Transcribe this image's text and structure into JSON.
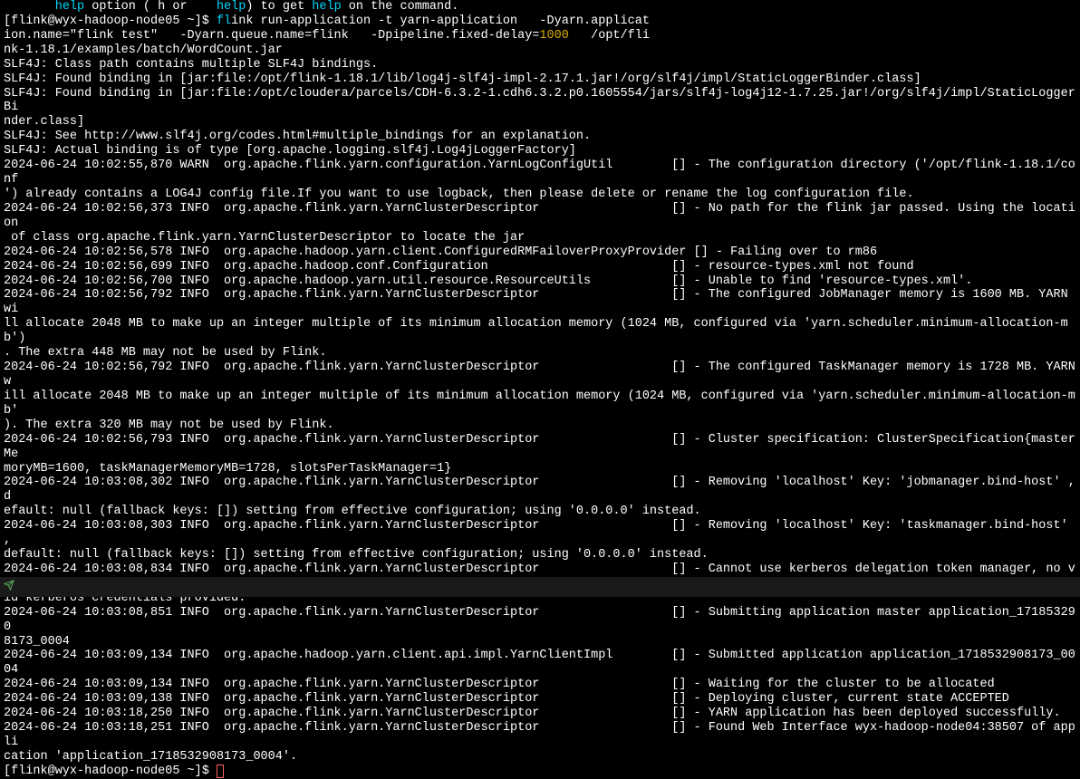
{
  "line0_prefix": "       ",
  "line0_word1": "help",
  "line0_mid": " option ( h or ",
  "line0_word2": "   help",
  "line0_mid2": ") to get ",
  "line0_word3": "help",
  "line0_end": " on the command.",
  "prompt1": "[flink@wyx-hadoop-node05 ~]$ ",
  "cmd_fl": "fl",
  "cmd_rest": "ink run-application -t yarn-application   -Dyarn.applicat\nion.name=\"flink test\"   -Dyarn.queue.name=flink   -Dpipeline.fixed-delay=",
  "cmd_1000": "1000",
  "cmd_path": "   /opt/fli\nnk-1.18.1/examples/batch/WordCount.jar",
  "slf4j_1": "SLF4J: Class path contains multiple SLF4J bindings.",
  "slf4j_2": "SLF4J: Found binding in [jar:file:/opt/flink-1.18.1/lib/log4j-slf4j-impl-2.17.1.jar!/org/slf4j/impl/StaticLoggerBinder.class]",
  "slf4j_3": "SLF4J: Found binding in [jar:file:/opt/cloudera/parcels/CDH-6.3.2-1.cdh6.3.2.p0.1605554/jars/slf4j-log4j12-1.7.25.jar!/org/slf4j/impl/StaticLoggerBi\nnder.class]",
  "slf4j_4": "SLF4J: See http://www.slf4j.org/codes.html#multiple_bindings for an explanation.",
  "slf4j_5": "SLF4J: Actual binding is of type [org.apache.logging.slf4j.Log4jLoggerFactory]",
  "log1": "2024-06-24 10:02:55,870 WARN  org.apache.flink.yarn.configuration.YarnLogConfigUtil        [] - The configuration directory ('/opt/flink-1.18.1/conf\n') already contains a LOG4J config file.If you want to use logback, then please delete or rename the log configuration file.",
  "log2": "2024-06-24 10:02:56,373 INFO  org.apache.flink.yarn.YarnClusterDescriptor                  [] - No path for the flink jar passed. Using the location\n of class org.apache.flink.yarn.YarnClusterDescriptor to locate the jar",
  "log3": "2024-06-24 10:02:56,578 INFO  org.apache.hadoop.yarn.client.ConfiguredRMFailoverProxyProvider [] - Failing over to rm86",
  "log4": "2024-06-24 10:02:56,699 INFO  org.apache.hadoop.conf.Configuration                         [] - resource-types.xml not found",
  "log5": "2024-06-24 10:02:56,700 INFO  org.apache.hadoop.yarn.util.resource.ResourceUtils           [] - Unable to find 'resource-types.xml'.",
  "log6": "2024-06-24 10:02:56,792 INFO  org.apache.flink.yarn.YarnClusterDescriptor                  [] - The configured JobManager memory is 1600 MB. YARN wi\nll allocate 2048 MB to make up an integer multiple of its minimum allocation memory (1024 MB, configured via 'yarn.scheduler.minimum-allocation-mb')\n. The extra 448 MB may not be used by Flink.",
  "log7": "2024-06-24 10:02:56,792 INFO  org.apache.flink.yarn.YarnClusterDescriptor                  [] - The configured TaskManager memory is 1728 MB. YARN w\nill allocate 2048 MB to make up an integer multiple of its minimum allocation memory (1024 MB, configured via 'yarn.scheduler.minimum-allocation-mb'\n). The extra 320 MB may not be used by Flink.",
  "log8": "2024-06-24 10:02:56,793 INFO  org.apache.flink.yarn.YarnClusterDescriptor                  [] - Cluster specification: ClusterSpecification{masterMe\nmoryMB=1600, taskManagerMemoryMB=1728, slotsPerTaskManager=1}",
  "log9": "2024-06-24 10:03:08,302 INFO  org.apache.flink.yarn.YarnClusterDescriptor                  [] - Removing 'localhost' Key: 'jobmanager.bind-host' , d\nefault: null (fallback keys: []) setting from effective configuration; using '0.0.0.0' instead.",
  "log10": "2024-06-24 10:03:08,303 INFO  org.apache.flink.yarn.YarnClusterDescriptor                  [] - Removing 'localhost' Key: 'taskmanager.bind-host' , \ndefault: null (fallback keys: []) setting from effective configuration; using '0.0.0.0' instead.",
  "log11": "2024-06-24 10:03:08,834 INFO  org.apache.flink.yarn.YarnClusterDescriptor                  [] - Cannot use kerberos delegation token manager, no val\nid kerberos credentials provided.",
  "log12": "2024-06-24 10:03:08,851 INFO  org.apache.flink.yarn.YarnClusterDescriptor                  [] - Submitting application master application_171853290\n8173_0004",
  "log13": "2024-06-24 10:03:09,134 INFO  org.apache.hadoop.yarn.client.api.impl.YarnClientImpl        [] - Submitted application application_1718532908173_0004",
  "log14": "2024-06-24 10:03:09,134 INFO  org.apache.flink.yarn.YarnClusterDescriptor                  [] - Waiting for the cluster to be allocated",
  "log15": "2024-06-24 10:03:09,138 INFO  org.apache.flink.yarn.YarnClusterDescriptor                  [] - Deploying cluster, current state ACCEPTED",
  "log16": "2024-06-24 10:03:18,250 INFO  org.apache.flink.yarn.YarnClusterDescriptor                  [] - YARN application has been deployed successfully.",
  "log17": "2024-06-24 10:03:18,251 INFO  org.apache.flink.yarn.YarnClusterDescriptor                  [] - Found Web Interface wyx-hadoop-node04:38507 of appli\ncation 'application_1718532908173_0004'.",
  "prompt2": "[flink@wyx-hadoop-node05 ~]$ "
}
